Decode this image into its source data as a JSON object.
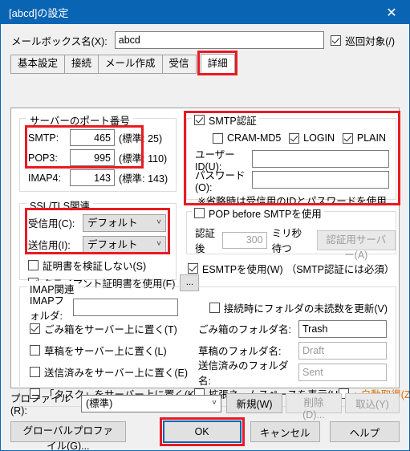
{
  "window": {
    "title": "[abcd]の設定",
    "close_label": "✕"
  },
  "mailbox": {
    "label": "メールボックス名(X):",
    "value": "abcd",
    "patrol_label": "巡回対象(/)",
    "patrol_checked": true
  },
  "tabs": [
    {
      "label": "基本設定",
      "active": false
    },
    {
      "label": "接続",
      "active": false
    },
    {
      "label": "メール作成",
      "active": false
    },
    {
      "label": "受信",
      "active": false
    },
    {
      "label": "詳細",
      "active": true
    }
  ],
  "server_ports": {
    "legend": "サーバーのポート番号",
    "rows": [
      {
        "label": "SMTP:",
        "value": "465",
        "standard": "(標準: 25)"
      },
      {
        "label": "POP3:",
        "value": "995",
        "standard": "(標準: 110)"
      },
      {
        "label": "IMAP4:",
        "value": "143",
        "standard": "(標準: 143)"
      }
    ]
  },
  "ssl_tls": {
    "legend": "SSL/TLS関連",
    "recv_label": "受信用(C):",
    "recv_value": "デフォルト",
    "send_label": "送信用(I):",
    "send_value": "デフォルト",
    "no_verify_label": "証明書を検証しない(S)",
    "no_verify_checked": false,
    "client_cert_label": "クライアント証明書を使用(F)",
    "client_cert_checked": true,
    "browse_label": "..."
  },
  "smtp_auth": {
    "title": "SMTP認証",
    "title_checked": true,
    "methods": [
      {
        "label": "CRAM-MD5",
        "checked": false
      },
      {
        "label": "LOGIN",
        "checked": true
      },
      {
        "label": "PLAIN",
        "checked": true
      }
    ],
    "userid_label": "ユーザーID(U):",
    "userid_value": "",
    "password_label": "パスワード(O):",
    "password_value": "",
    "note": "※省略時は受信用のIDとパスワードを使用"
  },
  "pop_before_smtp": {
    "title": "POP before SMTPを使用",
    "title_checked": false,
    "after_auth_label": "認証後",
    "wait_value": "300",
    "wait_unit": "ミリ秒待つ",
    "auth_server_button": "認証用サーバー(A)"
  },
  "esmtp": {
    "label": "ESMTPを使用(W)",
    "checked": true,
    "note": "（SMTP認証には必須）"
  },
  "imap": {
    "legend": "IMAP関連",
    "folder_label": "IMAPフォルダ:",
    "folder_value": "",
    "refresh_unread_label": "接続時にフォルダの未読数を更新(V)",
    "refresh_unread_checked": false,
    "rows": [
      {
        "cbx": "ごみ箱をサーバー上に置く(T)",
        "checked": true,
        "name_label": "ごみ箱のフォルダ名:",
        "name_value": "Trash",
        "disabled": false
      },
      {
        "cbx": "草稿をサーバー上に置く(L)",
        "checked": false,
        "name_label": "草稿のフォルダ名:",
        "name_value": "Draft",
        "disabled": true
      },
      {
        "cbx": "送信済みをサーバー上に置く(E)",
        "checked": false,
        "name_label": "送信済みのフォルダ名:",
        "name_value": "Sent",
        "disabled": true
      }
    ],
    "task_label": "「タスク」をサーバー上に置く(K)",
    "task_checked": false,
    "namespace_label": "拡張ネームスペースを表示(H)",
    "namespace_checked": false,
    "autoget_label": "↑ 自動取得(Z)",
    "autoget_checked": false
  },
  "profile": {
    "label": "プロファイル(R):",
    "value": "(標準)",
    "new_button": "新規(W)",
    "delete_button": "削除(D)...",
    "import_button": "取込(Y)"
  },
  "footer": {
    "global_profile": "グローバルプロファイル(G)...",
    "ok": "OK",
    "cancel": "キャンセル",
    "help": "ヘルプ"
  },
  "colors": {
    "title_bar": "#0a64b4",
    "highlight_red": "#e81b23",
    "focus_blue": "#0a64b4",
    "arrow_orange": "#e07000"
  }
}
